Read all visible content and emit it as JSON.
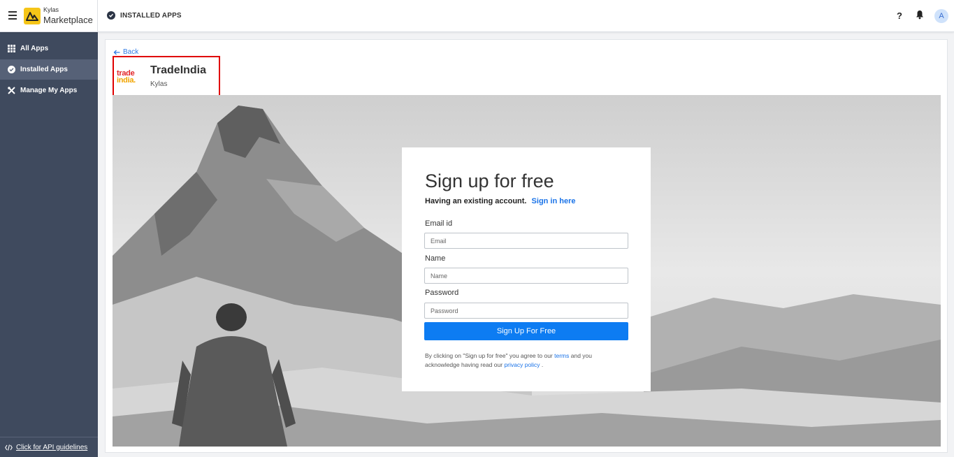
{
  "header": {
    "brand_small": "Kylas",
    "brand_big": "Marketplace",
    "page_title": "INSTALLED APPS",
    "help": "?",
    "avatar_initial": "A"
  },
  "sidebar": {
    "items": [
      {
        "label": "All Apps",
        "icon": "grid-icon",
        "active": false
      },
      {
        "label": "Installed Apps",
        "icon": "check-circle-icon",
        "active": true
      },
      {
        "label": "Manage My Apps",
        "icon": "tools-icon",
        "active": false
      }
    ],
    "footer_link": "Click for API guidelines"
  },
  "app": {
    "back_label": "Back",
    "logo_line1": "trade",
    "logo_line2": "india.",
    "name": "TradeIndia",
    "vendor": "Kylas"
  },
  "signup": {
    "title": "Sign up for free",
    "existing_text": "Having an existing account.",
    "signin_link": "Sign in here",
    "email_label": "Email id",
    "email_placeholder": "Email",
    "name_label": "Name",
    "name_placeholder": "Name",
    "password_label": "Password",
    "password_placeholder": "Password",
    "submit_label": "Sign Up For Free",
    "terms_prefix": "By clicking on \"Sign up for free\" you agree to our",
    "terms_link": "terms",
    "terms_middle": "and you acknowledge having read our",
    "privacy_link": "privacy policy",
    "terms_suffix": "."
  },
  "colors": {
    "sidebar_bg": "#3f4a5e",
    "accent": "#0d7cf2",
    "highlight_border": "#e00000",
    "brand_yellow": "#f5c518"
  }
}
